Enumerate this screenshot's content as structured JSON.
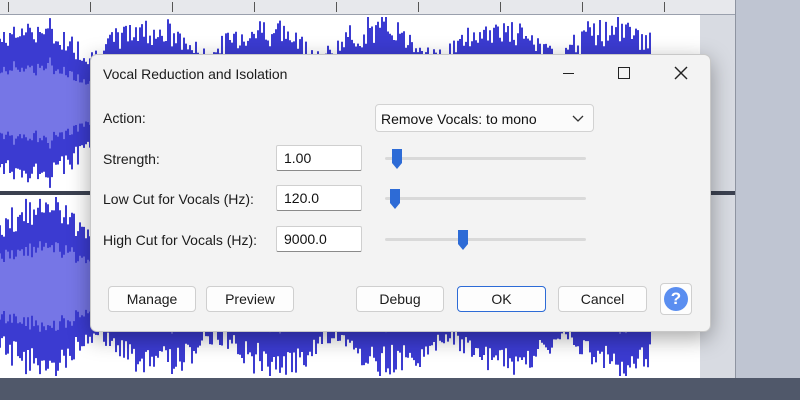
{
  "dialog": {
    "title": "Vocal Reduction and Isolation",
    "action_label": "Action:",
    "action_value": "Remove Vocals: to mono",
    "strength_label": "Strength:",
    "strength_value": "1.00",
    "strength_slider": 0.03,
    "low_cut_label": "Low Cut for Vocals (Hz):",
    "low_cut_value": "120.0",
    "low_cut_slider": 0.02,
    "high_cut_label": "High Cut for Vocals (Hz):",
    "high_cut_value": "9000.0",
    "high_cut_slider": 0.38,
    "buttons": {
      "manage": "Manage",
      "preview": "Preview",
      "debug": "Debug",
      "ok": "OK",
      "cancel": "Cancel",
      "help": "?"
    }
  },
  "colors": {
    "waveform": "#3b3bd1",
    "waveform_rms": "#7676e6",
    "slider_thumb": "#2d6bd6",
    "help_accent": "#5a8ef0"
  },
  "icons": [
    "minimize-icon",
    "maximize-icon",
    "close-icon",
    "chevron-down-icon",
    "help-icon"
  ]
}
